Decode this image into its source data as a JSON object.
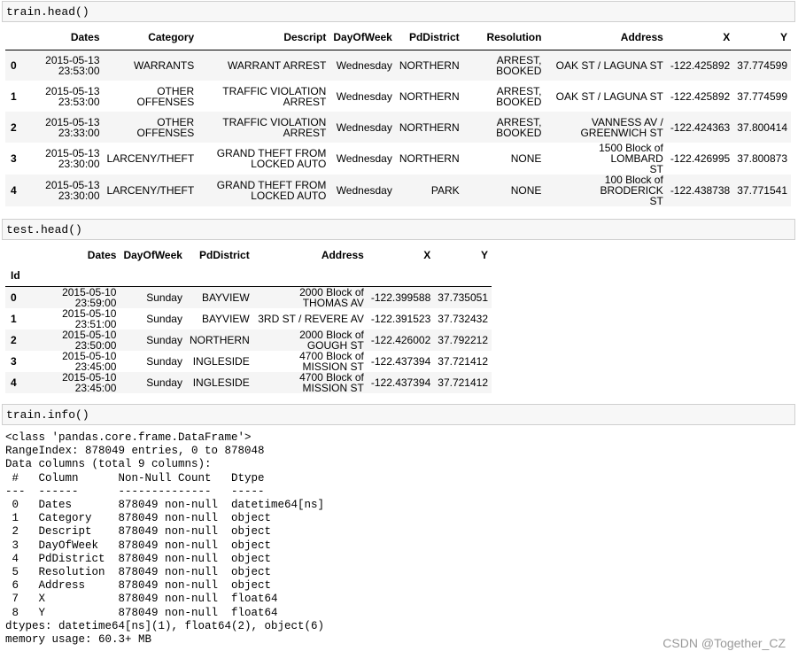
{
  "cells": {
    "train_head_code": "train.head()",
    "test_head_code": "test.head()",
    "train_info_code": "train.info()"
  },
  "train_table": {
    "columns": [
      "Dates",
      "Category",
      "Descript",
      "DayOfWeek",
      "PdDistrict",
      "Resolution",
      "Address",
      "X",
      "Y"
    ],
    "rows": [
      {
        "idx": "0",
        "cells": [
          "2015-05-13\n23:53:00",
          "WARRANTS",
          "WARRANT ARREST",
          "Wednesday",
          "NORTHERN",
          "ARREST,\nBOOKED",
          "OAK ST / LAGUNA ST",
          "-122.425892",
          "37.774599"
        ]
      },
      {
        "idx": "1",
        "cells": [
          "2015-05-13\n23:53:00",
          "OTHER\nOFFENSES",
          "TRAFFIC VIOLATION\nARREST",
          "Wednesday",
          "NORTHERN",
          "ARREST,\nBOOKED",
          "OAK ST / LAGUNA ST",
          "-122.425892",
          "37.774599"
        ]
      },
      {
        "idx": "2",
        "cells": [
          "2015-05-13\n23:33:00",
          "OTHER\nOFFENSES",
          "TRAFFIC VIOLATION\nARREST",
          "Wednesday",
          "NORTHERN",
          "ARREST,\nBOOKED",
          "VANNESS AV /\nGREENWICH ST",
          "-122.424363",
          "37.800414"
        ]
      },
      {
        "idx": "3",
        "cells": [
          "2015-05-13\n23:30:00",
          "LARCENY/THEFT",
          "GRAND THEFT FROM\nLOCKED AUTO",
          "Wednesday",
          "NORTHERN",
          "NONE",
          "1500 Block of LOMBARD\nST",
          "-122.426995",
          "37.800873"
        ]
      },
      {
        "idx": "4",
        "cells": [
          "2015-05-13\n23:30:00",
          "LARCENY/THEFT",
          "GRAND THEFT FROM\nLOCKED AUTO",
          "Wednesday",
          "PARK",
          "NONE",
          "100 Block of BRODERICK\nST",
          "-122.438738",
          "37.771541"
        ]
      }
    ]
  },
  "test_table": {
    "columns": [
      "Dates",
      "DayOfWeek",
      "PdDistrict",
      "Address",
      "X",
      "Y"
    ],
    "index_name": "Id",
    "rows": [
      {
        "idx": "0",
        "cells": [
          "2015-05-10 23:59:00",
          "Sunday",
          "BAYVIEW",
          "2000 Block of THOMAS AV",
          "-122.399588",
          "37.735051"
        ]
      },
      {
        "idx": "1",
        "cells": [
          "2015-05-10 23:51:00",
          "Sunday",
          "BAYVIEW",
          "3RD ST / REVERE AV",
          "-122.391523",
          "37.732432"
        ]
      },
      {
        "idx": "2",
        "cells": [
          "2015-05-10 23:50:00",
          "Sunday",
          "NORTHERN",
          "2000 Block of GOUGH ST",
          "-122.426002",
          "37.792212"
        ]
      },
      {
        "idx": "3",
        "cells": [
          "2015-05-10 23:45:00",
          "Sunday",
          "INGLESIDE",
          "4700 Block of MISSION ST",
          "-122.437394",
          "37.721412"
        ]
      },
      {
        "idx": "4",
        "cells": [
          "2015-05-10 23:45:00",
          "Sunday",
          "INGLESIDE",
          "4700 Block of MISSION ST",
          "-122.437394",
          "37.721412"
        ]
      }
    ]
  },
  "info_output": "<class 'pandas.core.frame.DataFrame'>\nRangeIndex: 878049 entries, 0 to 878048\nData columns (total 9 columns):\n #   Column      Non-Null Count   Dtype         \n---  ------      --------------   -----         \n 0   Dates       878049 non-null  datetime64[ns]\n 1   Category    878049 non-null  object        \n 2   Descript    878049 non-null  object        \n 3   DayOfWeek   878049 non-null  object        \n 4   PdDistrict  878049 non-null  object        \n 5   Resolution  878049 non-null  object        \n 6   Address     878049 non-null  object        \n 7   X           878049 non-null  float64       \n 8   Y           878049 non-null  float64       \ndtypes: datetime64[ns](1), float64(2), object(6)\nmemory usage: 60.3+ MB",
  "watermark": "CSDN @Together_CZ"
}
